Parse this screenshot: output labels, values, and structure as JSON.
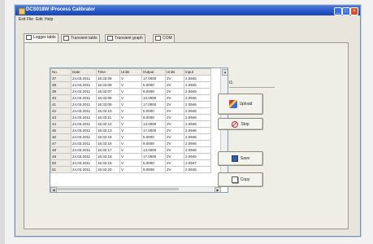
{
  "window": {
    "title": "DCS018W iProcess Calibrator"
  },
  "menu": [
    "Exit",
    "File",
    "Edit",
    "Help"
  ],
  "tabs": [
    "Logger table",
    "Transient table",
    "Transient graph",
    "COM"
  ],
  "table": {
    "headers": [
      "No.",
      "Date",
      "Time",
      "Units",
      "Output",
      "Units",
      "Input"
    ],
    "rows": [
      [
        "37",
        "24.03.2011",
        "16:32:06",
        "V",
        "17.0000",
        "2V",
        "2.0945"
      ],
      [
        "38",
        "24.03.2011",
        "16:32:06",
        "V",
        "5.0000",
        "2V",
        "2.0945"
      ],
      [
        "39",
        "24.03.2011",
        "16:32:07",
        "V",
        "9.0000",
        "2V",
        "2.0945"
      ],
      [
        "40",
        "24.03.2011",
        "16:32:08",
        "V",
        "13.0000",
        "2V",
        "2.0946"
      ],
      [
        "41",
        "24.03.2011",
        "16:32:09",
        "V",
        "17.0000",
        "2V",
        "2.0946"
      ],
      [
        "42",
        "24.03.2011",
        "16:32:10",
        "V",
        "5.0000",
        "2V",
        "2.0946"
      ],
      [
        "43",
        "24.03.2011",
        "16:32:11",
        "V",
        "9.0000",
        "2V",
        "2.0946"
      ],
      [
        "44",
        "24.03.2011",
        "16:32:12",
        "V",
        "13.0000",
        "2V",
        "2.0946"
      ],
      [
        "45",
        "24.03.2011",
        "16:32:13",
        "V",
        "17.0000",
        "2V",
        "2.0946"
      ],
      [
        "46",
        "24.03.2011",
        "16:32:15",
        "V",
        "5.0000",
        "2V",
        "2.0946"
      ],
      [
        "47",
        "24.03.2011",
        "16:32:16",
        "V",
        "9.0000",
        "2V",
        "2.0946"
      ],
      [
        "48",
        "24.03.2011",
        "16:32:17",
        "V",
        "13.0000",
        "2V",
        "2.0946"
      ],
      [
        "49",
        "24.03.2011",
        "16:32:18",
        "V",
        "17.0000",
        "2V",
        "2.0945"
      ],
      [
        "50",
        "24.03.2011",
        "16:32:19",
        "V",
        "5.0000",
        "2V",
        "2.0947"
      ],
      [
        "51",
        "24.03.2011",
        "16:32:20",
        "V",
        "9.0000",
        "2V",
        "2.0945"
      ]
    ]
  },
  "side": {
    "label": "t1:",
    "upload_label": "Upload",
    "stop_label": "Stop",
    "save_label": "Save",
    "copy_label": "Copy"
  },
  "colors": {
    "titlebar": "#2456c8",
    "accent": "#3a6bd6"
  },
  "icons": [
    "app-icon",
    "minimize-icon",
    "maximize-icon",
    "close-icon",
    "upload-pen-icon",
    "stop-icon",
    "save-icon",
    "copy-icon"
  ]
}
